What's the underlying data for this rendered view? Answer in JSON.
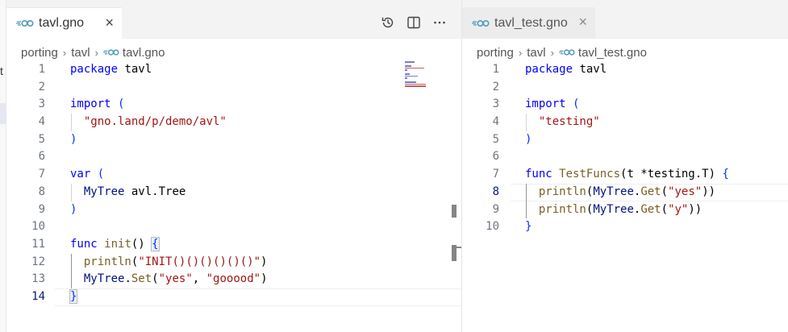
{
  "left_edge_fragment": "t",
  "left_pane": {
    "tab": {
      "label": "tavl.gno",
      "close": "×"
    },
    "actions": [
      {
        "name": "history-icon"
      },
      {
        "name": "split-editor-icon"
      },
      {
        "name": "more-actions-icon"
      }
    ],
    "breadcrumb": {
      "folder1": "porting",
      "folder2": "tavl",
      "file": "tavl.gno",
      "sep": "›"
    },
    "lines": [
      {
        "n": "1",
        "tokens": [
          [
            "kw",
            "package"
          ],
          [
            "plain",
            " tavl"
          ]
        ]
      },
      {
        "n": "2",
        "tokens": []
      },
      {
        "n": "3",
        "tokens": [
          [
            "kw",
            "import"
          ],
          [
            "plain",
            " "
          ],
          [
            "br1",
            "("
          ]
        ]
      },
      {
        "n": "4",
        "tokens": [
          [
            "plain",
            "  "
          ],
          [
            "str",
            "\"gno.land/p/demo/avl\""
          ]
        ]
      },
      {
        "n": "5",
        "tokens": [
          [
            "br1",
            ")"
          ]
        ]
      },
      {
        "n": "6",
        "tokens": []
      },
      {
        "n": "7",
        "tokens": [
          [
            "kw",
            "var"
          ],
          [
            "plain",
            " "
          ],
          [
            "br1",
            "("
          ]
        ]
      },
      {
        "n": "8",
        "tokens": [
          [
            "plain",
            "  "
          ],
          [
            "var",
            "MyTree"
          ],
          [
            "plain",
            " avl.Tree"
          ]
        ]
      },
      {
        "n": "9",
        "tokens": [
          [
            "br1",
            ")"
          ]
        ]
      },
      {
        "n": "10",
        "tokens": []
      },
      {
        "n": "11",
        "tokens": [
          [
            "kw",
            "func"
          ],
          [
            "plain",
            " "
          ],
          [
            "fn",
            "init"
          ],
          [
            "plain",
            "() "
          ],
          [
            "br1",
            "{"
          ]
        ]
      },
      {
        "n": "12",
        "tokens": [
          [
            "plain",
            "  "
          ],
          [
            "fn",
            "println"
          ],
          [
            "plain",
            "("
          ],
          [
            "str",
            "\"INIT()()()()()()\""
          ],
          [
            "plain",
            ")"
          ]
        ]
      },
      {
        "n": "13",
        "tokens": [
          [
            "plain",
            "  "
          ],
          [
            "var",
            "MyTree"
          ],
          [
            "plain",
            "."
          ],
          [
            "fn",
            "Set"
          ],
          [
            "plain",
            "("
          ],
          [
            "str",
            "\"yes\""
          ],
          [
            "plain",
            ", "
          ],
          [
            "str",
            "\"gooood\""
          ],
          [
            "plain",
            ")"
          ]
        ]
      },
      {
        "n": "14",
        "tokens": [
          [
            "br1",
            "}"
          ]
        ]
      }
    ]
  },
  "right_pane": {
    "tab": {
      "label": "tavl_test.gno",
      "close": "×"
    },
    "breadcrumb": {
      "folder1": "porting",
      "folder2": "tavl",
      "file": "tavl_test.gno",
      "sep": "›"
    },
    "lines": [
      {
        "n": "1",
        "tokens": [
          [
            "kw",
            "package"
          ],
          [
            "plain",
            " tavl"
          ]
        ]
      },
      {
        "n": "2",
        "tokens": []
      },
      {
        "n": "3",
        "tokens": [
          [
            "kw",
            "import"
          ],
          [
            "plain",
            " "
          ],
          [
            "br1",
            "("
          ]
        ]
      },
      {
        "n": "4",
        "tokens": [
          [
            "plain",
            "  "
          ],
          [
            "str",
            "\"testing\""
          ]
        ]
      },
      {
        "n": "5",
        "tokens": [
          [
            "br1",
            ")"
          ]
        ]
      },
      {
        "n": "6",
        "tokens": []
      },
      {
        "n": "7",
        "tokens": [
          [
            "kw",
            "func"
          ],
          [
            "plain",
            " "
          ],
          [
            "fn",
            "TestFuncs"
          ],
          [
            "plain",
            "(t *testing.T) "
          ],
          [
            "br1",
            "{"
          ]
        ]
      },
      {
        "n": "8",
        "tokens": [
          [
            "plain",
            "  "
          ],
          [
            "fn",
            "println"
          ],
          [
            "plain",
            "("
          ],
          [
            "var",
            "MyTree"
          ],
          [
            "plain",
            "."
          ],
          [
            "fn",
            "Get"
          ],
          [
            "plain",
            "("
          ],
          [
            "str",
            "\"yes\""
          ],
          [
            "plain",
            "))"
          ]
        ]
      },
      {
        "n": "9",
        "tokens": [
          [
            "plain",
            "  "
          ],
          [
            "fn",
            "println"
          ],
          [
            "plain",
            "("
          ],
          [
            "var",
            "MyTree"
          ],
          [
            "plain",
            "."
          ],
          [
            "fn",
            "Get"
          ],
          [
            "plain",
            "("
          ],
          [
            "str",
            "\"y\""
          ],
          [
            "plain",
            "))"
          ]
        ]
      },
      {
        "n": "10",
        "tokens": [
          [
            "br1",
            "}"
          ]
        ]
      }
    ]
  },
  "colors": {
    "keyword": "#0000ff",
    "string": "#a31515",
    "function": "#795e26",
    "variable": "#001080",
    "bracket": "#0431fa"
  }
}
